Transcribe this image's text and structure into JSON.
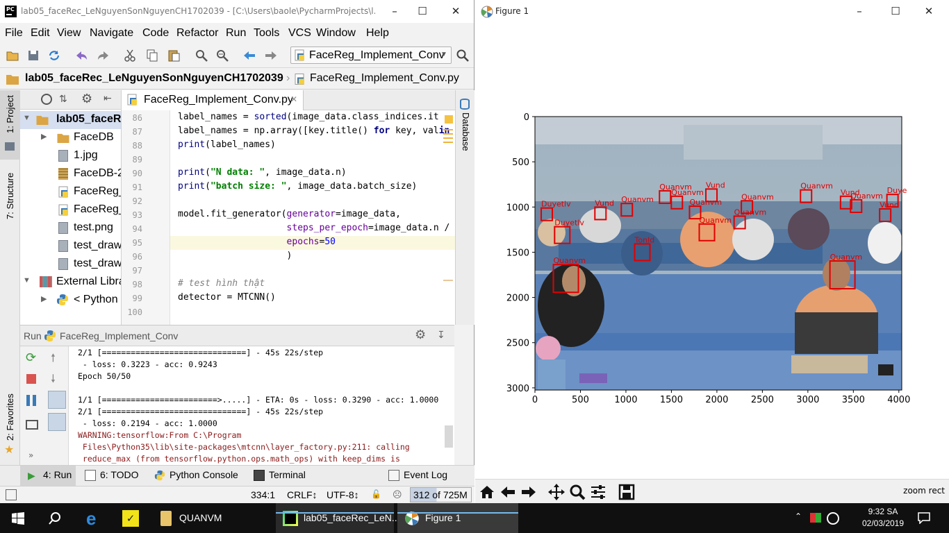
{
  "pycharm": {
    "window_title": "lab05_faceRec_LeNguyenSonNguyenCH1702039 - [C:\\Users\\baole\\PycharmProjects\\l...",
    "menu": [
      "File",
      "Edit",
      "View",
      "Navigate",
      "Code",
      "Refactor",
      "Run",
      "Tools",
      "VCS",
      "Window",
      "Help"
    ],
    "run_config": "FaceReg_Implement_Conv",
    "breadcrumb": [
      "lab05_faceRec_LeNguyenSonNguyenCH1702039",
      "FaceReg_Implement_Conv.py"
    ],
    "left_tabs": [
      "1: Project",
      "7: Structure",
      "2: Favorites"
    ],
    "right_tab": "Database",
    "project_tree": {
      "root": "lab05_faceRe",
      "items": [
        "FaceDB",
        "1.jpg",
        "FaceDB-20",
        "FaceReg_I",
        "FaceReg_I",
        "test.png",
        "test_draw",
        "test_draw"
      ],
      "external": "External Libra",
      "python": "< Python"
    },
    "editor": {
      "tab": "FaceReg_Implement_Conv.py",
      "lines": [
        {
          "n": "86",
          "tokens": [
            [
              "",
              "label_names = "
            ],
            [
              "bi",
              "sorted"
            ],
            [
              "",
              "(image_data.class_indices.it"
            ]
          ]
        },
        {
          "n": "87",
          "tokens": [
            [
              "",
              "label_names = np.array([key.title() "
            ],
            [
              "kw",
              "for"
            ],
            [
              "",
              " key, val"
            ],
            [
              "kw",
              "in"
            ]
          ]
        },
        {
          "n": "88",
          "tokens": [
            [
              "bi",
              "print"
            ],
            [
              "",
              "(label_names)"
            ]
          ]
        },
        {
          "n": "89",
          "tokens": []
        },
        {
          "n": "90",
          "tokens": [
            [
              "bi",
              "print"
            ],
            [
              "",
              "("
            ],
            [
              "str",
              "\"N data: \""
            ],
            [
              "",
              ", image_data.n)"
            ]
          ]
        },
        {
          "n": "91",
          "tokens": [
            [
              "bi",
              "print"
            ],
            [
              "",
              "("
            ],
            [
              "str",
              "\"batch size: \""
            ],
            [
              "",
              ", image_data.batch_size)"
            ]
          ]
        },
        {
          "n": "92",
          "tokens": []
        },
        {
          "n": "93",
          "tokens": [
            [
              "",
              "model.fit_generator("
            ],
            [
              "param",
              "generator"
            ],
            [
              "",
              "=image_data,"
            ]
          ]
        },
        {
          "n": "94",
          "tokens": [
            [
              "",
              "                    "
            ],
            [
              "param",
              "steps_per_epoch"
            ],
            [
              "",
              "=image_data.n /"
            ]
          ]
        },
        {
          "n": "95",
          "tokens": [
            [
              "",
              "                    "
            ],
            [
              "param",
              "epochs"
            ],
            [
              "",
              "="
            ],
            [
              "num",
              "50"
            ]
          ]
        },
        {
          "n": "96",
          "tokens": [
            [
              "",
              "                    )"
            ]
          ]
        },
        {
          "n": "97",
          "tokens": []
        },
        {
          "n": "98",
          "tokens": [
            [
              "cmt",
              "# test hình thật"
            ]
          ]
        },
        {
          "n": "99",
          "tokens": [
            [
              "",
              "detector = MTCNN()"
            ]
          ]
        },
        {
          "n": "100",
          "tokens": []
        }
      ]
    },
    "run": {
      "title": "Run",
      "config": "FaceReg_Implement_Conv",
      "output": [
        {
          "t": "2/1 [==============================] - 45s 22s/step",
          "warn": false
        },
        {
          "t": " - loss: 0.3223 - acc: 0.9243",
          "warn": false
        },
        {
          "t": "Epoch 50/50",
          "warn": false
        },
        {
          "t": "",
          "warn": false
        },
        {
          "t": "1/1 [========================>.....] - ETA: 0s - loss: 0.3290 - acc: 1.0000",
          "warn": false
        },
        {
          "t": "2/1 [==============================] - 45s 22s/step",
          "warn": false
        },
        {
          "t": " - loss: 0.2194 - acc: 1.0000",
          "warn": false
        },
        {
          "t": "WARNING:tensorflow:From C:\\Program",
          "warn": true
        },
        {
          "t": " Files\\Python35\\lib\\site-packages\\mtcnn\\layer_factory.py:211: calling",
          "warn": true
        },
        {
          "t": " reduce_max (from tensorflow.python.ops.math_ops) with keep_dims is",
          "warn": true
        }
      ]
    },
    "bottom_tabs": [
      "4: Run",
      "6: TODO",
      "Python Console",
      "Terminal",
      "Event Log"
    ],
    "status": {
      "position": "334:1",
      "line_sep": "CRLF↕",
      "encoding": "UTF-8↕",
      "memory": "312 of 725M"
    }
  },
  "figure": {
    "window_title": "Figure 1",
    "x_ticks": [
      "0",
      "500",
      "1000",
      "1500",
      "2000",
      "2500",
      "3000",
      "3500",
      "4000"
    ],
    "y_ticks": [
      "0",
      "500",
      "1000",
      "1500",
      "2000",
      "2500",
      "3000"
    ],
    "status": "zoom rect",
    "faces": [
      {
        "label": "Duyetlv",
        "x": 130,
        "y": 1080
      },
      {
        "label": "Duyetlv",
        "x": 300,
        "y": 1310
      },
      {
        "label": "Vund",
        "x": 720,
        "y": 1070
      },
      {
        "label": "Quanvm",
        "x": 1010,
        "y": 1030
      },
      {
        "label": "Quanvm",
        "x": 1430,
        "y": 890
      },
      {
        "label": "Quanvm",
        "x": 1560,
        "y": 950
      },
      {
        "label": "Quanvm",
        "x": 1760,
        "y": 1060
      },
      {
        "label": "Vund",
        "x": 1940,
        "y": 870
      },
      {
        "label": "Quanvm",
        "x": 1890,
        "y": 1280
      },
      {
        "label": "Quanvm",
        "x": 2330,
        "y": 1000
      },
      {
        "label": "Quanvm",
        "x": 2250,
        "y": 1170
      },
      {
        "label": "Quanvm",
        "x": 2980,
        "y": 880
      },
      {
        "label": "Vund",
        "x": 3420,
        "y": 950
      },
      {
        "label": "Quanvm",
        "x": 3530,
        "y": 990
      },
      {
        "label": "Vund",
        "x": 3850,
        "y": 1090
      },
      {
        "label": "Duye",
        "x": 3930,
        "y": 930
      },
      {
        "label": "Tonld",
        "x": 1180,
        "y": 1500
      },
      {
        "label": "Quanvm",
        "x": 340,
        "y": 1790
      },
      {
        "label": "Quanvm",
        "x": 3380,
        "y": 1750
      }
    ]
  },
  "taskbar": {
    "apps": [
      "QUANVM",
      "lab05_faceRec_LeN...",
      "Figure 1"
    ],
    "time": "9:32 SA",
    "date": "02/03/2019"
  }
}
